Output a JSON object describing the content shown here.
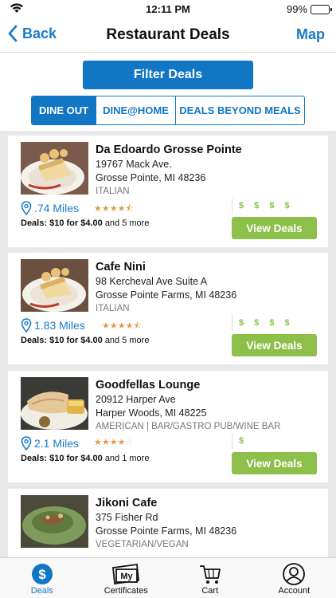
{
  "status": {
    "time": "12:11 PM",
    "battery": "99%"
  },
  "nav": {
    "back_label": "Back",
    "title": "Restaurant Deals",
    "map_label": "Map"
  },
  "filter": {
    "button_label": "Filter Deals",
    "segments": [
      {
        "label": "DINE OUT",
        "active": true
      },
      {
        "label": "DINE@HOME",
        "active": false
      },
      {
        "label": "DEALS BEYOND MEALS",
        "active": false
      }
    ]
  },
  "restaurants": [
    {
      "name": "Da Edoardo Grosse Pointe",
      "address_line1": "19767 Mack Ave.",
      "address_line2": "Grosse Pointe, MI 48236",
      "cuisine": "ITALIAN",
      "distance": ".74 Miles",
      "rating": 4.5,
      "price_level": 4,
      "price_text": "$ $ $ $",
      "deal_prefix": "Deals:",
      "deal_main": "$10 for $4.00",
      "deal_more": "and 5 more",
      "button_label": "View Deals"
    },
    {
      "name": "Cafe Nini",
      "address_line1": "98 Kercheval Ave Suite A",
      "address_line2": "Grosse Pointe Farms, MI 48236",
      "cuisine": "ITALIAN",
      "distance": "1.83 Miles",
      "rating": 4.5,
      "price_level": 4,
      "price_text": "$ $ $ $",
      "deal_prefix": "Deals:",
      "deal_main": "$10 for $4.00",
      "deal_more": "and 5 more",
      "button_label": "View Deals"
    },
    {
      "name": "Goodfellas Lounge",
      "address_line1": "20912 Harper Ave",
      "address_line2": "Harper Woods, MI 48225",
      "cuisine": "AMERICAN | BAR/GASTRO PUB/WINE BAR",
      "distance": "2.1 Miles",
      "rating": 4,
      "price_level": 1,
      "price_text": "$",
      "deal_prefix": "Deals:",
      "deal_main": "$10 for $4.00",
      "deal_more": "and 1 more",
      "button_label": "View Deals"
    },
    {
      "name": "Jikoni Cafe",
      "address_line1": "375 Fisher Rd",
      "address_line2": "Grosse Pointe Farms, MI 48236",
      "cuisine": "VEGETARIAN/VEGAN",
      "distance": "",
      "rating": 0,
      "price_level": 0,
      "price_text": "",
      "deal_prefix": "",
      "deal_main": "",
      "deal_more": "",
      "button_label": ""
    }
  ],
  "tabs": [
    {
      "label": "Deals",
      "icon": "dollar-icon",
      "active": true
    },
    {
      "label": "Certificates",
      "icon": "certificate-icon",
      "active": false
    },
    {
      "label": "Cart",
      "icon": "cart-icon",
      "active": false
    },
    {
      "label": "Account",
      "icon": "account-icon",
      "active": false
    }
  ],
  "colors": {
    "primary_blue": "#1176c3",
    "accent_green": "#8dc04a",
    "star_orange": "#e09a4a"
  }
}
